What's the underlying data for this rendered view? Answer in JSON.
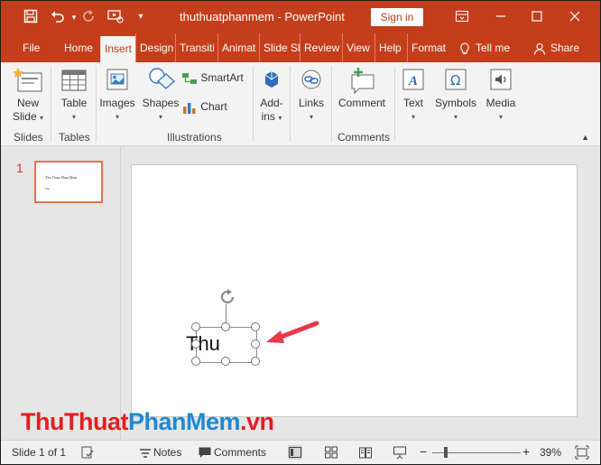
{
  "titlebar": {
    "title": "thuthuatphanmem  -  PowerPoint",
    "sign_in": "Sign in",
    "icons": [
      "save-icon",
      "undo-icon",
      "redo-icon",
      "present-icon",
      "customize-icon"
    ],
    "window": [
      "ribbon-display-icon",
      "minimize-icon",
      "maximize-icon",
      "close-icon"
    ]
  },
  "tabs": {
    "file": "File",
    "home": "Home",
    "insert": "Insert",
    "design": "Design",
    "transitions": "Transiti",
    "animations": "Animat",
    "slideshow": "Slide Sl",
    "review": "Review",
    "view": "View",
    "help": "Help",
    "format": "Format",
    "tell_me": "Tell me",
    "share": "Share"
  },
  "ribbon": {
    "new_slide_1": "New",
    "new_slide_2": "Slide",
    "table": "Table",
    "images": "Images",
    "shapes": "Shapes",
    "smartart": "SmartArt",
    "chart": "Chart",
    "addins_1": "Add-",
    "addins_2": "ins",
    "links": "Links",
    "comment": "Comment",
    "text": "Text",
    "symbols": "Symbols",
    "media": "Media",
    "groups": {
      "slides": "Slides",
      "tables": "Tables",
      "illustrations": "Illustrations",
      "comments": "Comments"
    }
  },
  "slides_pane": {
    "slide_number": "1",
    "thumb_title": "Thu Thuat Phan Mem",
    "thumb_body": "Thu"
  },
  "slide": {
    "textbox_text": "Thu"
  },
  "watermark": {
    "part1": "ThuThuat",
    "part2": "PhanMem",
    "part3": ".vn"
  },
  "statusbar": {
    "slide_info": "Slide 1 of 1",
    "notes": "Notes",
    "comments": "Comments",
    "zoom": "39%",
    "zoom_fraction": 0.39
  },
  "colors": {
    "accent": "#c43e1c",
    "arrow": "#e8394a",
    "watermark_red": "#e31e1e",
    "watermark_blue": "#1f8ad1"
  }
}
